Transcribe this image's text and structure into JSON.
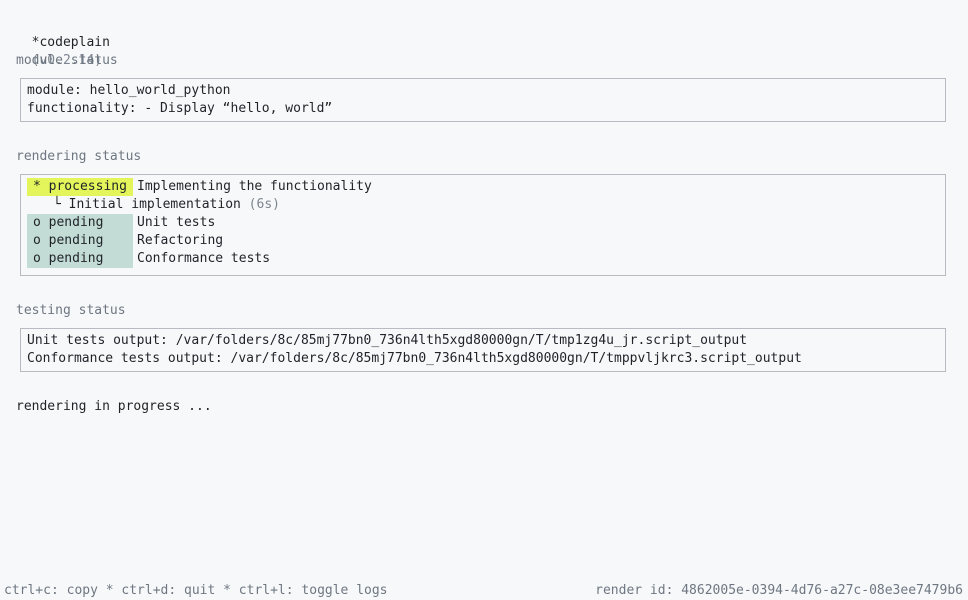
{
  "header": {
    "app_name": "*codeplain",
    "version": "(v0.2.14)"
  },
  "module_status": {
    "title": "module status",
    "module_label": "module:",
    "module_value": "hello_world_python",
    "functionality_label": "functionality:",
    "functionality_value": "- Display “hello, world”"
  },
  "rendering_status": {
    "title": "rendering status",
    "rows": [
      {
        "status": "* processing",
        "task": "Implementing the functionality"
      },
      {
        "status": "o pending",
        "task": "Unit tests"
      },
      {
        "status": "o pending",
        "task": "Refactoring"
      },
      {
        "status": "o pending",
        "task": "Conformance tests"
      }
    ],
    "subtask": {
      "branch": "└",
      "label": "Initial implementation",
      "elapsed": "(6s)"
    }
  },
  "testing_status": {
    "title": "testing status",
    "unit_label": "Unit tests output:",
    "unit_path": "/var/folders/8c/85mj77bn0_736n4lth5xgd80000gn/T/tmp1zg4u_jr.script_output",
    "conformance_label": "Conformance tests output:",
    "conformance_path": "/var/folders/8c/85mj77bn0_736n4lth5xgd80000gn/T/tmppvljkrc3.script_output"
  },
  "progress_message": "rendering in progress ...",
  "footer": {
    "shortcuts": "ctrl+c: copy * ctrl+d: quit * ctrl+l: toggle logs",
    "render_id": "render id: 4862005e-0394-4d76-a27c-08e3ee7479b6"
  },
  "colors": {
    "processing": "#e3f55a",
    "pending": "#c4dcd6",
    "background": "#f7f8fa"
  }
}
